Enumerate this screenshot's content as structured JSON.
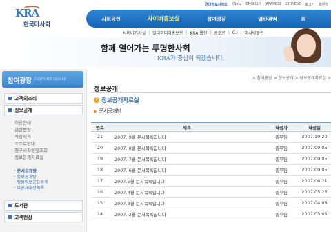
{
  "brand": {
    "mark": "KRA",
    "name": "한국마사회"
  },
  "topbar": [
    "경마정보사이트",
    "KNetz",
    "ENGLISH",
    "JAPANESE",
    "CHINESE",
    "로그인",
    "회원가"
  ],
  "gnb": [
    "사회공헌",
    "사이버홍보실",
    "참여광장",
    "열린경영",
    "회"
  ],
  "gnb_active": 1,
  "subnav": [
    "사이버기자실",
    "멀티미디어홍보관",
    "KRA 웹진",
    "공모전",
    "C.I",
    "마사박물관"
  ],
  "banner": {
    "line1": "함께 열어가는 투명한사회",
    "line2": "KRA가 중심이 되겠습니다."
  },
  "sidebar": {
    "title": "참여광장",
    "subtitle": "CUSTOMER SQUARE",
    "menus": [
      "고객의소리",
      "정보공개",
      "도서관",
      "고객헌장"
    ],
    "submenu": [
      "이용안내",
      "관련법령",
      "각종서식",
      "수수료안내",
      "청구서작성및조회",
      "정보공개자료실"
    ],
    "subsub": [
      "문서공개방",
      "정보공개방",
      "행정정보공표목록",
      "비공개대상목록"
    ]
  },
  "main": {
    "breadcrumb": "> 참여광장 > 정보공개 > 정보공개자료실 >",
    "page_title": "정보공개",
    "section_title": "정보공개자료실",
    "sub_title": "문서공개방",
    "table": {
      "headers": [
        "번호",
        "제목",
        "작성자",
        "작성일"
      ],
      "rows": [
        [
          "21",
          "2007. 9월 문서목록입니다",
          "총무팀",
          "2007.10.20"
        ],
        [
          "20",
          "2007. 8월 문서목록입니다",
          "총무팀",
          "2007.09.05"
        ],
        [
          "19",
          "2007. 7월 문서목록입니다",
          "총무팀",
          "2007.09.05"
        ],
        [
          "18",
          "2007. 6월 문서목록입니다",
          "총무팀",
          "2007.09.05"
        ],
        [
          "17",
          "2007.5월 문서목록입니다",
          "총무팀",
          "2007.06.21"
        ],
        [
          "16",
          "2007.4월 문서목록입니다",
          "총무팀",
          "2007.05.25"
        ],
        [
          "15",
          "2007.3월 문서목록입니다",
          "총무팀",
          "2007.04.08"
        ],
        [
          "14",
          "2007. 2월 문서목록입니다",
          "총무팀",
          "2007.03.03"
        ]
      ]
    }
  }
}
